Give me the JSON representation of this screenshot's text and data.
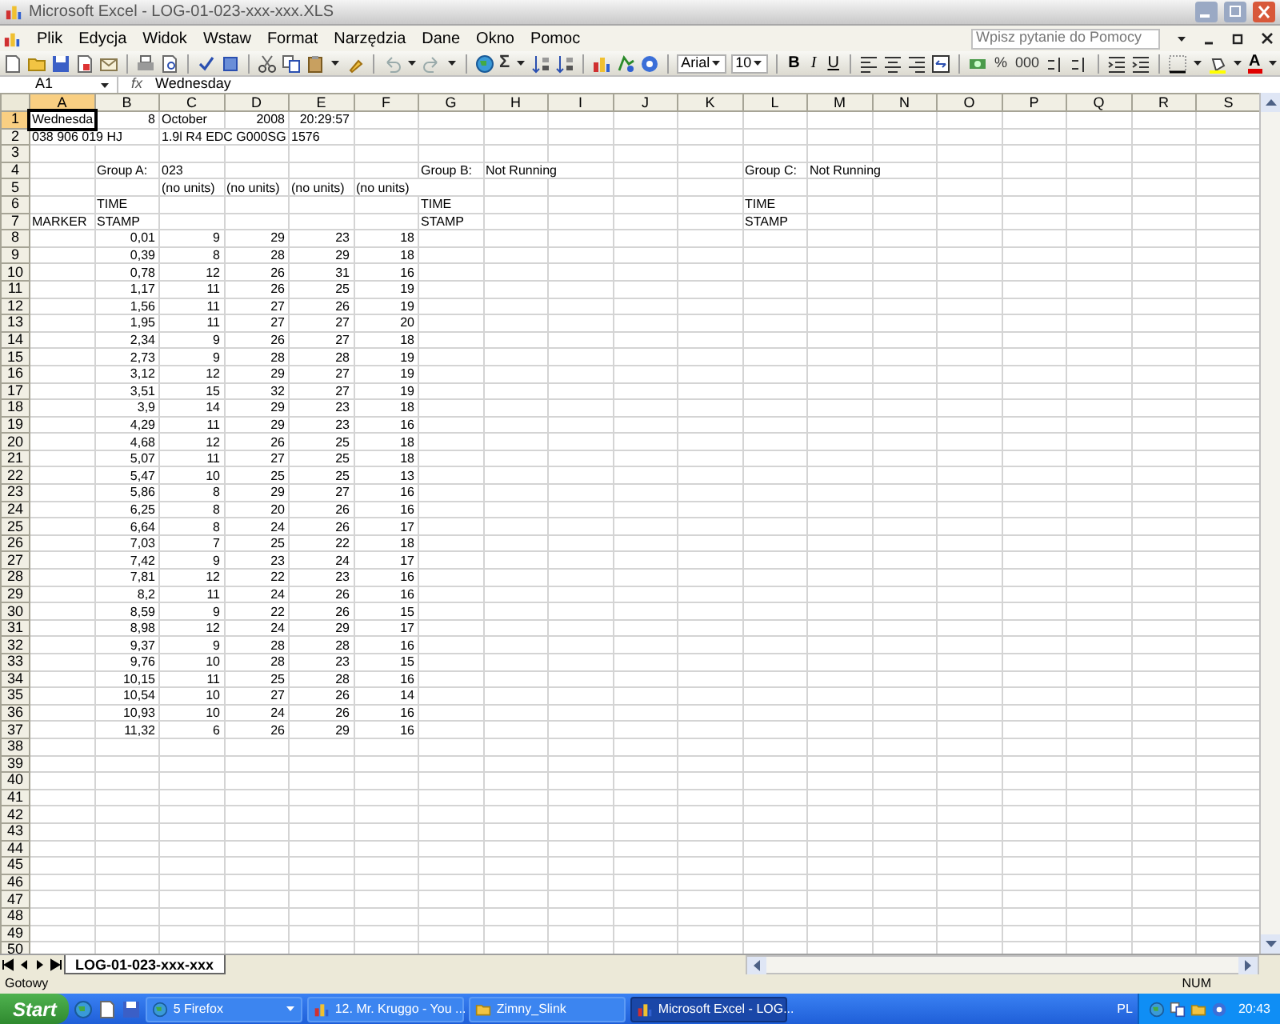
{
  "window": {
    "title": "Microsoft Excel - LOG-01-023-xxx-xxx.XLS"
  },
  "menu": [
    "Plik",
    "Edycja",
    "Widok",
    "Wstaw",
    "Format",
    "Narzędzia",
    "Dane",
    "Okno",
    "Pomoc"
  ],
  "help_box": {
    "placeholder": "Wpisz pytanie do Pomocy"
  },
  "toolbar": {
    "autosum": "Σ",
    "font": "Arial",
    "font_size": "10",
    "style_buttons": [
      "B",
      "I",
      "U"
    ],
    "number_buttons": [
      "%",
      "000"
    ],
    "font_color": "A"
  },
  "formula_bar": {
    "name_box": "A1",
    "fx": "fx",
    "value": "Wednesday"
  },
  "columns": [
    "A",
    "B",
    "C",
    "D",
    "E",
    "F",
    "G",
    "H",
    "I",
    "J",
    "K",
    "L",
    "M",
    "N",
    "O",
    "P",
    "Q",
    "R",
    "S"
  ],
  "rows": [
    {
      "row": "1",
      "cells": [
        {
          "text": "Wednesda",
          "kind": "text",
          "selected": true
        },
        {
          "text": "8",
          "kind": "number"
        },
        {
          "text": "October",
          "kind": "text"
        },
        {
          "text": "2008",
          "kind": "number"
        },
        {
          "text": "20:29:57",
          "kind": "number"
        }
      ]
    },
    {
      "row": "2",
      "cells": [
        {
          "text": "038 906 019 HJ",
          "kind": "text"
        },
        null,
        {
          "text": "1.9l R4 EDC G000SG",
          "kind": "text"
        },
        null,
        {
          "text": "1576",
          "kind": "text"
        }
      ]
    },
    {
      "row": "3"
    },
    {
      "row": "4",
      "cells": [
        null,
        {
          "text": "Group A:",
          "kind": "text"
        },
        {
          "text": "023",
          "kind": "text"
        },
        null,
        null,
        null,
        {
          "text": "Group B:",
          "kind": "text"
        },
        {
          "text": "Not Running",
          "kind": "text"
        },
        null,
        null,
        null,
        {
          "text": "Group C:",
          "kind": "text"
        },
        {
          "text": "Not Running",
          "kind": "text"
        }
      ]
    },
    {
      "row": "5",
      "cells": [
        null,
        null,
        {
          "text": "(no units)",
          "kind": "text"
        },
        {
          "text": "(no units)",
          "kind": "text"
        },
        {
          "text": "(no units)",
          "kind": "text"
        },
        {
          "text": "(no units)",
          "kind": "text"
        }
      ]
    },
    {
      "row": "6",
      "cells": [
        null,
        {
          "text": "TIME",
          "kind": "text"
        },
        null,
        null,
        null,
        null,
        {
          "text": "TIME",
          "kind": "text"
        },
        null,
        null,
        null,
        null,
        {
          "text": "TIME",
          "kind": "text"
        }
      ]
    },
    {
      "row": "7",
      "cells": [
        {
          "text": "MARKER",
          "kind": "text"
        },
        {
          "text": "STAMP",
          "kind": "text"
        },
        null,
        null,
        null,
        null,
        {
          "text": "STAMP",
          "kind": "text"
        },
        null,
        null,
        null,
        null,
        {
          "text": "STAMP",
          "kind": "text"
        }
      ]
    },
    {
      "row": "8",
      "values": [
        "0,01",
        "9",
        "29",
        "23",
        "18"
      ]
    },
    {
      "row": "9",
      "values": [
        "0,39",
        "8",
        "28",
        "29",
        "18"
      ]
    },
    {
      "row": "10",
      "values": [
        "0,78",
        "12",
        "26",
        "31",
        "16"
      ]
    },
    {
      "row": "11",
      "values": [
        "1,17",
        "11",
        "26",
        "25",
        "19"
      ]
    },
    {
      "row": "12",
      "values": [
        "1,56",
        "11",
        "27",
        "26",
        "19"
      ]
    },
    {
      "row": "13",
      "values": [
        "1,95",
        "11",
        "27",
        "27",
        "20"
      ]
    },
    {
      "row": "14",
      "values": [
        "2,34",
        "9",
        "26",
        "27",
        "18"
      ]
    },
    {
      "row": "15",
      "values": [
        "2,73",
        "9",
        "28",
        "28",
        "19"
      ]
    },
    {
      "row": "16",
      "values": [
        "3,12",
        "12",
        "29",
        "27",
        "19"
      ]
    },
    {
      "row": "17",
      "values": [
        "3,51",
        "15",
        "32",
        "27",
        "19"
      ]
    },
    {
      "row": "18",
      "values": [
        "3,9",
        "14",
        "29",
        "23",
        "18"
      ]
    },
    {
      "row": "19",
      "values": [
        "4,29",
        "11",
        "29",
        "23",
        "16"
      ]
    },
    {
      "row": "20",
      "values": [
        "4,68",
        "12",
        "26",
        "25",
        "18"
      ]
    },
    {
      "row": "21",
      "values": [
        "5,07",
        "11",
        "27",
        "25",
        "18"
      ]
    },
    {
      "row": "22",
      "values": [
        "5,47",
        "10",
        "25",
        "25",
        "13"
      ]
    },
    {
      "row": "23",
      "values": [
        "5,86",
        "8",
        "29",
        "27",
        "16"
      ]
    },
    {
      "row": "24",
      "values": [
        "6,25",
        "8",
        "20",
        "26",
        "16"
      ]
    },
    {
      "row": "25",
      "values": [
        "6,64",
        "8",
        "24",
        "26",
        "17"
      ]
    },
    {
      "row": "26",
      "values": [
        "7,03",
        "7",
        "25",
        "22",
        "18"
      ]
    },
    {
      "row": "27",
      "values": [
        "7,42",
        "9",
        "23",
        "24",
        "17"
      ]
    },
    {
      "row": "28",
      "values": [
        "7,81",
        "12",
        "22",
        "23",
        "16"
      ]
    },
    {
      "row": "29",
      "values": [
        "8,2",
        "11",
        "24",
        "26",
        "16"
      ]
    },
    {
      "row": "30",
      "values": [
        "8,59",
        "9",
        "22",
        "26",
        "15"
      ]
    },
    {
      "row": "31",
      "values": [
        "8,98",
        "12",
        "24",
        "29",
        "17"
      ]
    },
    {
      "row": "32",
      "values": [
        "9,37",
        "9",
        "28",
        "28",
        "16"
      ]
    },
    {
      "row": "33",
      "values": [
        "9,76",
        "10",
        "28",
        "23",
        "15"
      ]
    },
    {
      "row": "34",
      "values": [
        "10,15",
        "11",
        "25",
        "28",
        "16"
      ]
    },
    {
      "row": "35",
      "values": [
        "10,54",
        "10",
        "27",
        "26",
        "14"
      ]
    },
    {
      "row": "36",
      "values": [
        "10,93",
        "10",
        "24",
        "26",
        "16"
      ]
    },
    {
      "row": "37",
      "values": [
        "11,32",
        "6",
        "26",
        "29",
        "16"
      ]
    },
    {
      "row": "38"
    },
    {
      "row": "39"
    },
    {
      "row": "40"
    },
    {
      "row": "41"
    },
    {
      "row": "42"
    },
    {
      "row": "43"
    },
    {
      "row": "44"
    },
    {
      "row": "45"
    },
    {
      "row": "46"
    },
    {
      "row": "47"
    },
    {
      "row": "48"
    },
    {
      "row": "49"
    },
    {
      "row": "50"
    }
  ],
  "sheet_tabs": [
    {
      "label": "LOG-01-023-xxx-xxx",
      "selected": true
    }
  ],
  "status_bar": {
    "status": "Gotowy",
    "indicator": "NUM"
  },
  "taskbar": {
    "start": "Start",
    "items": [
      {
        "label": "5 Firefox",
        "selected": false,
        "kind": "group"
      },
      {
        "label": "12. Mr. Kruggo - You ...",
        "selected": false,
        "kind": "app"
      },
      {
        "label": "Zimny_Slink",
        "selected": false,
        "kind": "folder"
      },
      {
        "label": "Microsoft Excel - LOG...",
        "selected": true,
        "kind": "excel"
      }
    ],
    "language": "PL",
    "clock": "20:43"
  }
}
